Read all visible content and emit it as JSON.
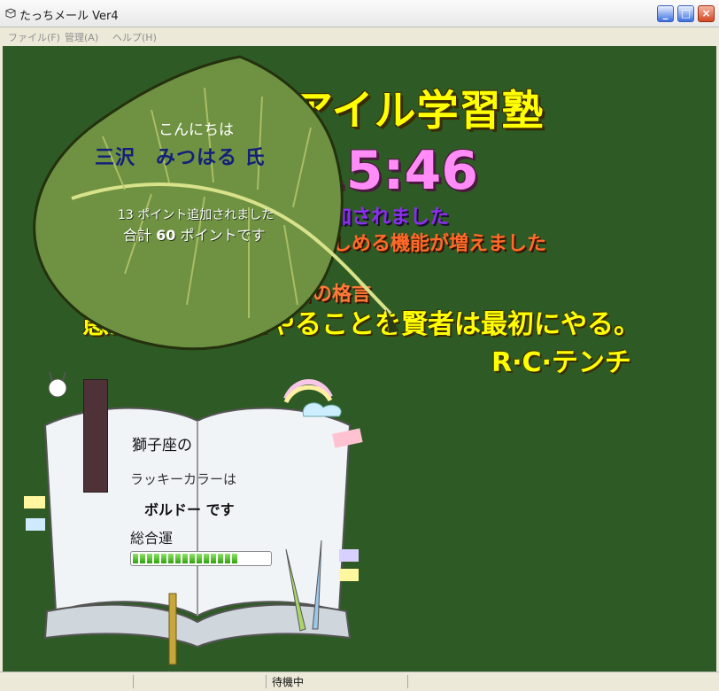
{
  "window": {
    "title": "たっちメール Ver4",
    "minimize": "_",
    "maximize": "□",
    "close": "×"
  },
  "menu": [
    {
      "label": "ファイル(F)"
    },
    {
      "label": "管理(A)"
    },
    {
      "label": "ヘルプ(H)"
    }
  ],
  "board": {
    "banner_title": "アイル学習塾",
    "clock": "15:46",
    "notice_1": "々と追加されました",
    "notice_2": "まが楽しめる機能が増えました",
    "motto_heading": "今日の格言",
    "proverb": "愚か者が最後にやることを賢者は最初にやる。",
    "author": "R·C·テンチ"
  },
  "leaf_card": {
    "greeting": "こんにちは",
    "user_name": "三沢　みつはる 氏",
    "points_added": "13 ポイント追加されました",
    "points_total_prefix": "合計",
    "points_total_value": "60",
    "points_total_suffix": "ポイントです"
  },
  "horoscope": {
    "sign": "獅子座の",
    "lucky_label": "ラッキーカラーは",
    "lucky_color": "ボルドー です",
    "overall_label": "総合運",
    "overall_fortune": 0.78,
    "bookmark_color": "#4e3238"
  },
  "status": {
    "text": "待機中"
  },
  "colors": {
    "board": "#2e5b25",
    "title_yellow": "#ffff00",
    "clock_pink": "#ff8cf7"
  }
}
